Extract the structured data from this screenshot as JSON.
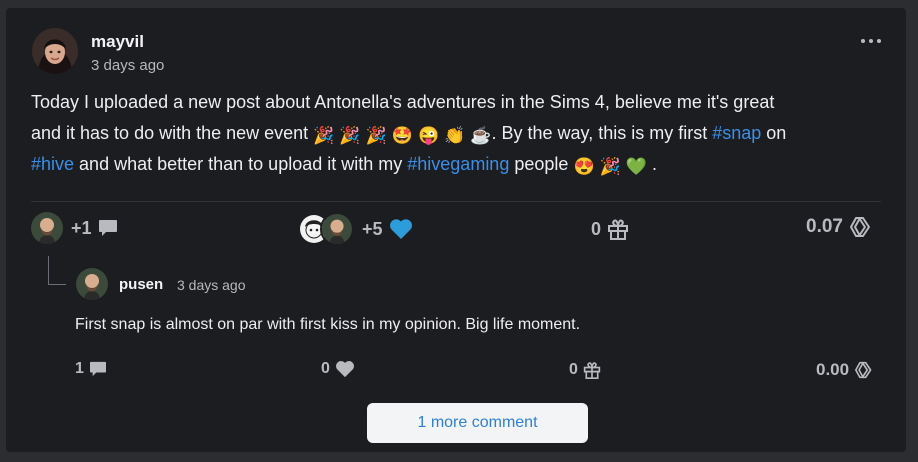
{
  "post": {
    "author": "mayvil",
    "time": "3 days ago",
    "line1": "Today I uploaded a new post about Antonella's adventures in the Sims 4, believe me it's great",
    "line2_a": "and it has to do with the new event",
    "line2_b": ". By the way, this is my first",
    "tag_snap": "#snap",
    "line2_c": "on",
    "tag_hive": "#hive",
    "line3_a": "and what better than to upload it with my",
    "tag_hivegaming": "#hivegaming",
    "line3_b": "people",
    "line3_end": ".",
    "emoji": {
      "party": "🎉",
      "star_eyes": "🤩",
      "wink_tongue": "😜",
      "clap": "👏",
      "coffee": "☕",
      "heart_eyes": "😍",
      "green_heart": "💚"
    },
    "stats": {
      "comments": "+1",
      "votes": "+5",
      "tips": "0",
      "payout": "0.07"
    }
  },
  "reply": {
    "author": "pusen",
    "time": "3 days ago",
    "body": "First snap is almost on par with first kiss in my opinion. Big life moment.",
    "stats": {
      "comments": "1",
      "votes": "0",
      "tips": "0",
      "payout": "0.00"
    }
  },
  "more_comments_label": "1 more comment",
  "colors": {
    "background": "#1c1d21",
    "link": "#3a8fe8",
    "vote_heart": "#2d9cdb"
  }
}
